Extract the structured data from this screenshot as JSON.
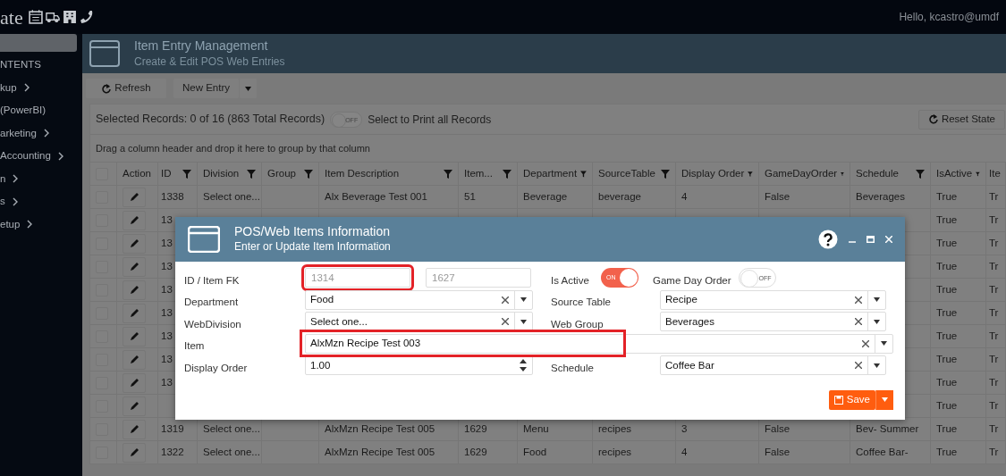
{
  "top_bar": {
    "logo": "ate",
    "greeting": "Hello, kcastro@umdf"
  },
  "sidebar": {
    "heading": "NTENTS",
    "items": [
      {
        "label": "kup",
        "chevron": true
      },
      {
        "label": "(PowerBI)",
        "chevron": false
      },
      {
        "label": "arketing",
        "chevron": true
      },
      {
        "label": "Accounting",
        "chevron": true
      },
      {
        "label": "n",
        "chevron": true
      },
      {
        "label": "s",
        "chevron": true
      },
      {
        "label": "etup",
        "chevron": true
      }
    ]
  },
  "page_header": {
    "title": "Item Entry Management",
    "subtitle": "Create & Edit POS Web Entries"
  },
  "toolbar": {
    "refresh": "Refresh",
    "new_entry": "New Entry"
  },
  "records_bar": {
    "summary": "Selected Records: 0 of 16 (863 Total Records)",
    "print_all": {
      "on": false,
      "label": "OFF",
      "caption": "Select to Print all Records"
    },
    "reset": "Reset State"
  },
  "group_hint": "Drag a column header and drop it here to group by that column",
  "table": {
    "header_checked": false,
    "action_label": "Action",
    "columns": [
      {
        "label": "ID",
        "filter": true
      },
      {
        "label": "Division",
        "filter": true
      },
      {
        "label": "Group",
        "filter": true
      },
      {
        "label": "Item Description",
        "filter": true
      },
      {
        "label": "Item...",
        "filter": true
      },
      {
        "label": "Department",
        "filter": true
      },
      {
        "label": "SourceTable",
        "filter": true
      },
      {
        "label": "Display Order",
        "filter": true
      },
      {
        "label": "GameDayOrder",
        "filter": true
      },
      {
        "label": "Schedule",
        "filter": true
      },
      {
        "label": "IsActive",
        "filter": true
      },
      {
        "label": "Ite",
        "filter": false
      }
    ],
    "rows": [
      {
        "checked": false,
        "cells": [
          "1338",
          "Select one...",
          null,
          "Alx Beverage Test 001",
          "51",
          "Beverage",
          "beverage",
          "4",
          "False",
          "Beverages",
          "True",
          "Tr"
        ]
      },
      {
        "checked": false,
        "cells": [
          "13",
          null,
          null,
          null,
          null,
          null,
          null,
          null,
          null,
          null,
          "True",
          "Tr"
        ]
      },
      {
        "checked": false,
        "cells": [
          "13",
          null,
          null,
          null,
          null,
          null,
          null,
          null,
          null,
          null,
          "True",
          "Tr"
        ]
      },
      {
        "checked": false,
        "cells": [
          "13",
          null,
          null,
          null,
          null,
          null,
          null,
          null,
          null,
          null,
          "True",
          "Tr"
        ]
      },
      {
        "checked": false,
        "cells": [
          "13",
          null,
          null,
          null,
          null,
          null,
          null,
          null,
          null,
          null,
          "True",
          "Tr"
        ]
      },
      {
        "checked": false,
        "cells": [
          "13",
          null,
          null,
          null,
          null,
          null,
          null,
          null,
          null,
          null,
          "True",
          "Tr"
        ]
      },
      {
        "checked": false,
        "cells": [
          "13",
          null,
          null,
          null,
          null,
          null,
          null,
          null,
          null,
          null,
          "True",
          "Tr"
        ]
      },
      {
        "checked": false,
        "cells": [
          "13",
          null,
          null,
          null,
          null,
          null,
          null,
          null,
          null,
          null,
          "True",
          "Tr"
        ]
      },
      {
        "checked": false,
        "cells": [
          "13",
          null,
          null,
          null,
          null,
          null,
          null,
          null,
          null,
          null,
          "True",
          "Tr"
        ]
      },
      {
        "checked": false,
        "cells": [
          null,
          null,
          null,
          null,
          null,
          null,
          null,
          null,
          null,
          null,
          "True",
          "Tr"
        ]
      },
      {
        "checked": false,
        "cells": [
          "1319",
          "Select one...",
          null,
          "AlxMzn Recipe Test 005",
          "1629",
          "Menu",
          "recipes",
          "3",
          "False",
          "Bev- Summer",
          "True",
          "Tr"
        ]
      },
      {
        "checked": false,
        "cells": [
          "1322",
          "Select one...",
          null,
          "AlxMzn Recipe Test 005",
          "1629",
          "Food",
          "recipes",
          "4",
          "False",
          "Coffee Bar-",
          "True",
          "Tr"
        ]
      }
    ]
  },
  "dialog": {
    "title": "POS/Web Items Information",
    "subtitle": "Enter or Update Item Information",
    "rows": [
      {
        "kind": "ids",
        "label": "ID / Item FK",
        "values": [
          "1314",
          "1627"
        ],
        "highlighted": true,
        "toggles": [
          {
            "label": "Is Active",
            "on": true,
            "text": "ON"
          },
          {
            "label": "Game Day Order",
            "on": false,
            "text": "OFF"
          }
        ]
      },
      {
        "kind": "combo",
        "label": "Department",
        "value": "Food",
        "right_label": "Source Table",
        "right_value": "Recipe"
      },
      {
        "kind": "combo",
        "label": "WebDivision",
        "value": "Select one...",
        "right_label": "Web Group",
        "right_value": "Beverages"
      },
      {
        "kind": "wide",
        "label": "Item",
        "value": "AlxMzn Recipe Test 003",
        "highlighted": true
      },
      {
        "kind": "number",
        "label": "Display Order",
        "value": "1.00",
        "right_label": "Schedule",
        "right_value": "Coffee Bar"
      }
    ],
    "save": "Save"
  }
}
